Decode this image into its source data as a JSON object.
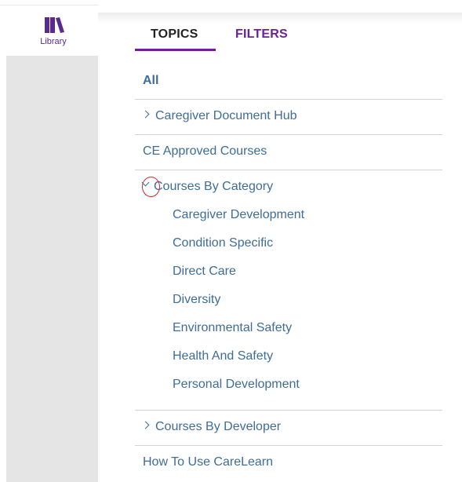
{
  "sidebar": {
    "library_label": "Library",
    "icon": "library-books-icon",
    "accent": "#5a2a8c"
  },
  "tabs": [
    {
      "label": "TOPICS",
      "active": true
    },
    {
      "label": "FILTERS",
      "active": false
    }
  ],
  "colors": {
    "link": "#3e6d98",
    "tab_accent": "#6f1f99",
    "highlight_circle": "#d8232a",
    "sidebar_gray": "#e5e5e5"
  },
  "topics": {
    "all": "All",
    "caregiver_hub": "Caregiver Document Hub",
    "ce_courses": "CE Approved Courses",
    "by_category": {
      "label": "Courses By Category",
      "expanded": true,
      "items": [
        "Caregiver Development",
        "Condition Specific",
        "Direct Care",
        "Diversity",
        "Environmental Safety",
        "Health And Safety",
        "Personal Development"
      ]
    },
    "by_developer": "Courses By Developer",
    "how_to": "How To Use CareLearn"
  }
}
